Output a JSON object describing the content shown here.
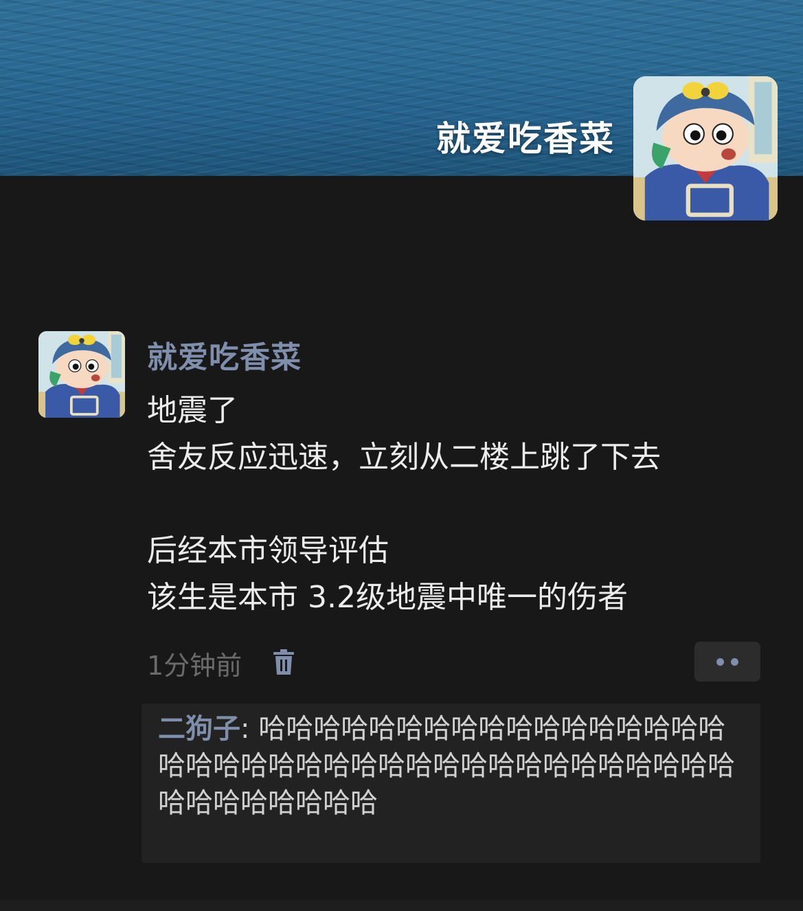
{
  "profile": {
    "name": "就爱吃香菜",
    "avatar_icon": "cartoon-boy-avatar-icon",
    "cover_icon": "sea-waves-cover-image"
  },
  "post": {
    "author": "就爱吃香菜",
    "lines": [
      "地震了",
      "舍友反应迅速，立刻从二楼上跳了下去",
      "",
      "后经本市领导评估",
      "该生是本市 3.2级地震中唯一的伤者"
    ],
    "time": "1分钟前",
    "delete_icon": "trash-icon",
    "more_icon": "two-dots-more-icon"
  },
  "comments": [
    {
      "user": "二狗子",
      "separator": ": ",
      "text": "哈哈哈哈哈哈哈哈哈哈哈哈哈哈哈哈哈哈哈哈哈哈哈哈哈哈哈哈哈哈哈哈哈哈哈哈哈哈哈哈哈哈哈哈哈哈"
    }
  ],
  "colors": {
    "background": "#181818",
    "name_link": "#7f8eaa",
    "text": "#ececec",
    "muted": "#6b6b6b",
    "comment_bg": "#222222"
  }
}
